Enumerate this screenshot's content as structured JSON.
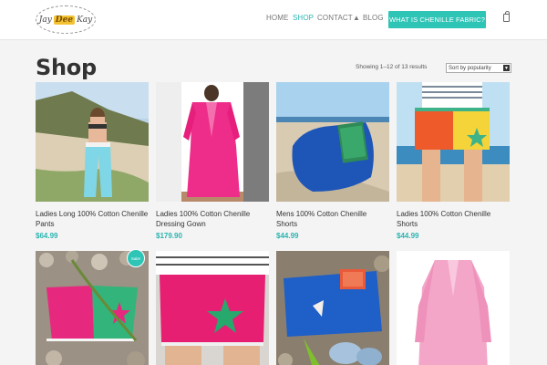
{
  "header": {
    "logo": {
      "left": "Jay",
      "mid": "Dee",
      "right": "Kay"
    },
    "nav": {
      "home": "HOME",
      "shop": "SHOP",
      "contact": "CONTACT",
      "blog": "BLOG"
    },
    "cta_label": "WHAT IS CHENILLE FABRIC?"
  },
  "shop": {
    "title": "Shop",
    "result_count": "Showing 1–12 of 13 results",
    "sort_value": "Sort by popularity"
  },
  "products": [
    {
      "name": "Ladies Long 100% Cotton Chenille Pants",
      "price": "$64.99"
    },
    {
      "name": "Ladies 100% Cotton Chenille Dressing Gown",
      "price": "$179.90"
    },
    {
      "name": "Mens 100% Cotton Chenille Shorts",
      "price": "$44.99"
    },
    {
      "name": "Ladies 100% Cotton Chenille Shorts",
      "price": "$44.99"
    },
    {
      "name": "",
      "price": "",
      "badge": "Sale!"
    },
    {
      "name": "",
      "price": ""
    },
    {
      "name": "",
      "price": ""
    },
    {
      "name": "",
      "price": ""
    }
  ],
  "colors": {
    "accent": "#2ec4b6",
    "price": "#2ab5b0"
  }
}
